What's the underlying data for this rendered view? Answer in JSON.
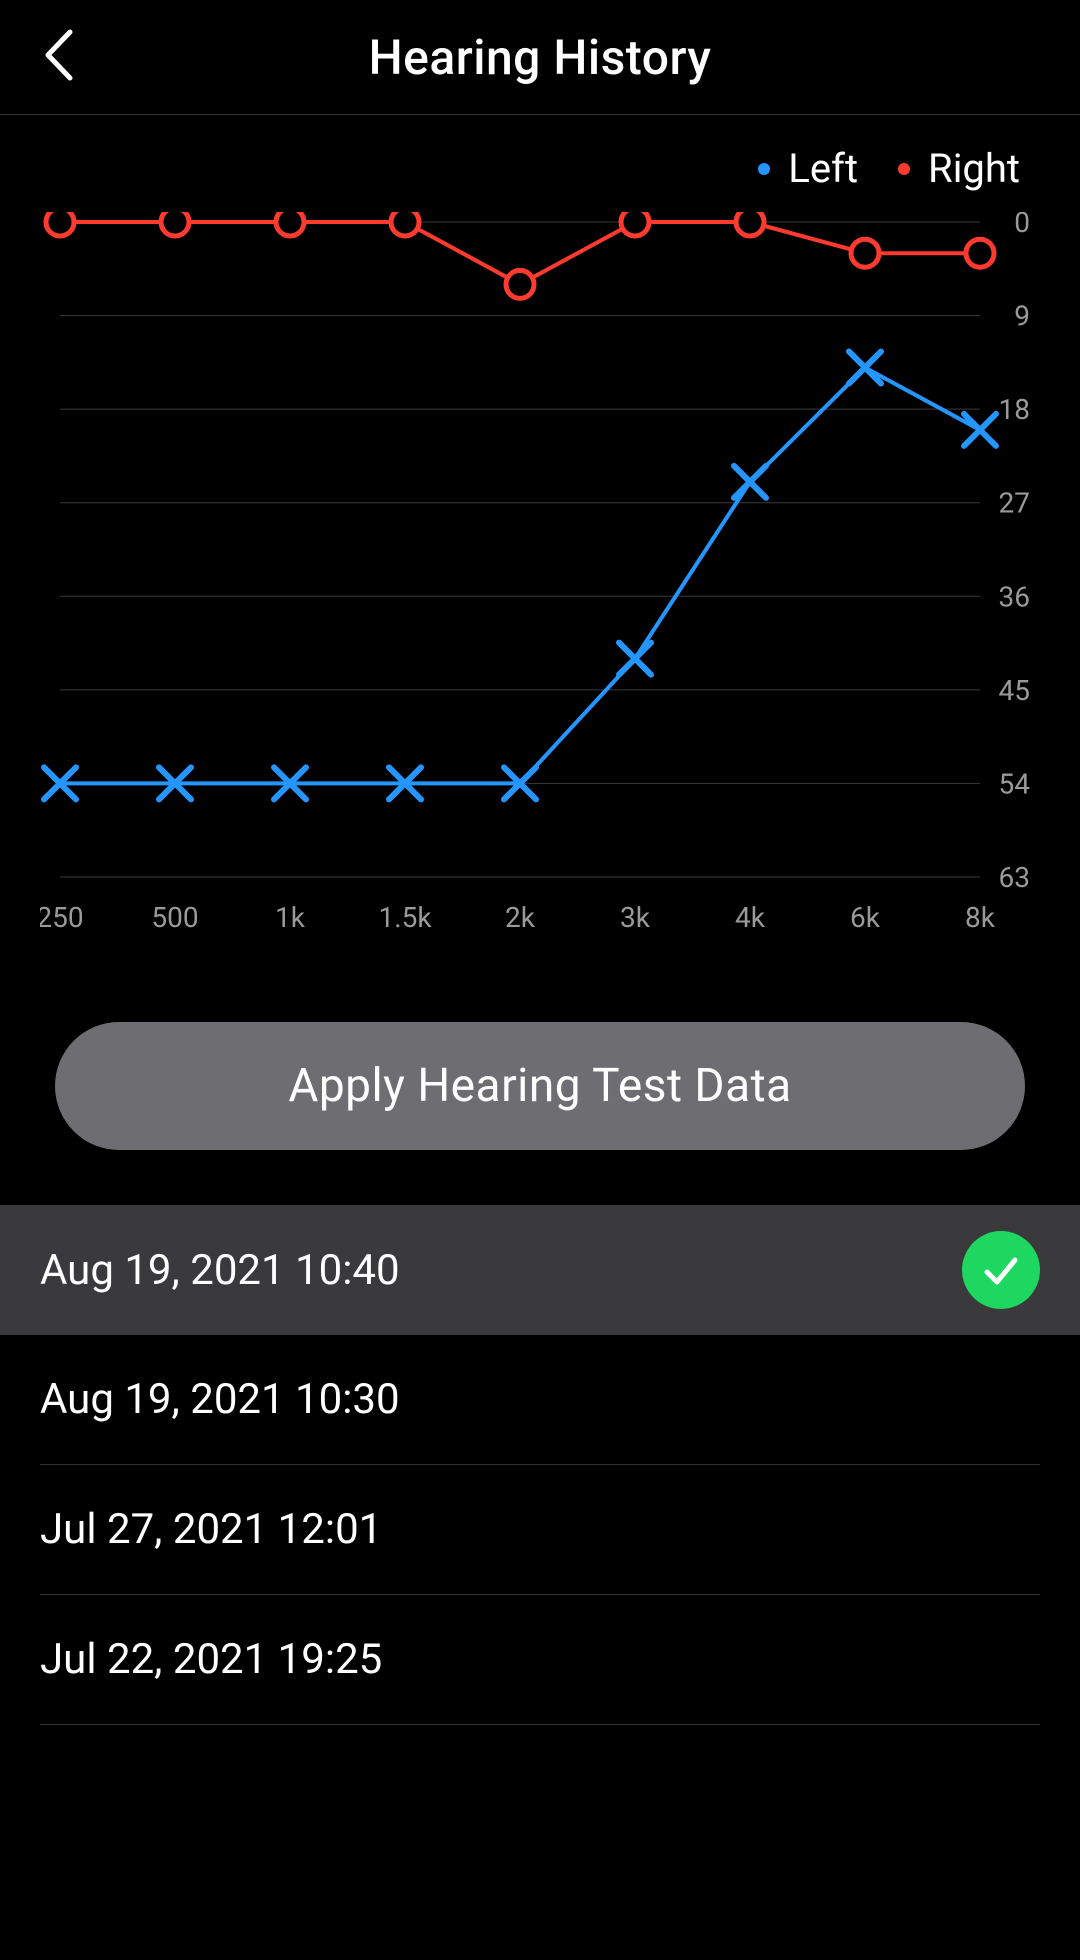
{
  "header": {
    "title": "Hearing History"
  },
  "legend": {
    "left_label": "Left",
    "right_label": "Right",
    "left_color": "#2596ff",
    "right_color": "#ff3b30"
  },
  "chart_data": {
    "type": "line",
    "categories": [
      "250",
      "500",
      "1k",
      "1.5k",
      "2k",
      "3k",
      "4k",
      "6k",
      "8k"
    ],
    "xlabel": "",
    "ylabel": "",
    "ylim": [
      0,
      63
    ],
    "y_ticks": [
      0,
      9,
      18,
      27,
      36,
      45,
      54,
      63
    ],
    "series": [
      {
        "name": "Left",
        "color": "#2596ff",
        "marker": "x",
        "values": [
          54,
          54,
          54,
          54,
          54,
          42,
          25,
          14,
          20
        ]
      },
      {
        "name": "Right",
        "color": "#ff3b30",
        "marker": "o",
        "values": [
          0,
          0,
          0,
          0,
          6,
          0,
          0,
          3,
          3
        ]
      }
    ]
  },
  "apply_button": "Apply Hearing Test Data",
  "history": [
    {
      "label": "Aug 19, 2021 10:40",
      "selected": true
    },
    {
      "label": "Aug 19, 2021 10:30",
      "selected": false
    },
    {
      "label": "Jul 27, 2021 12:01",
      "selected": false
    },
    {
      "label": "Jul 22, 2021 19:25",
      "selected": false
    }
  ]
}
